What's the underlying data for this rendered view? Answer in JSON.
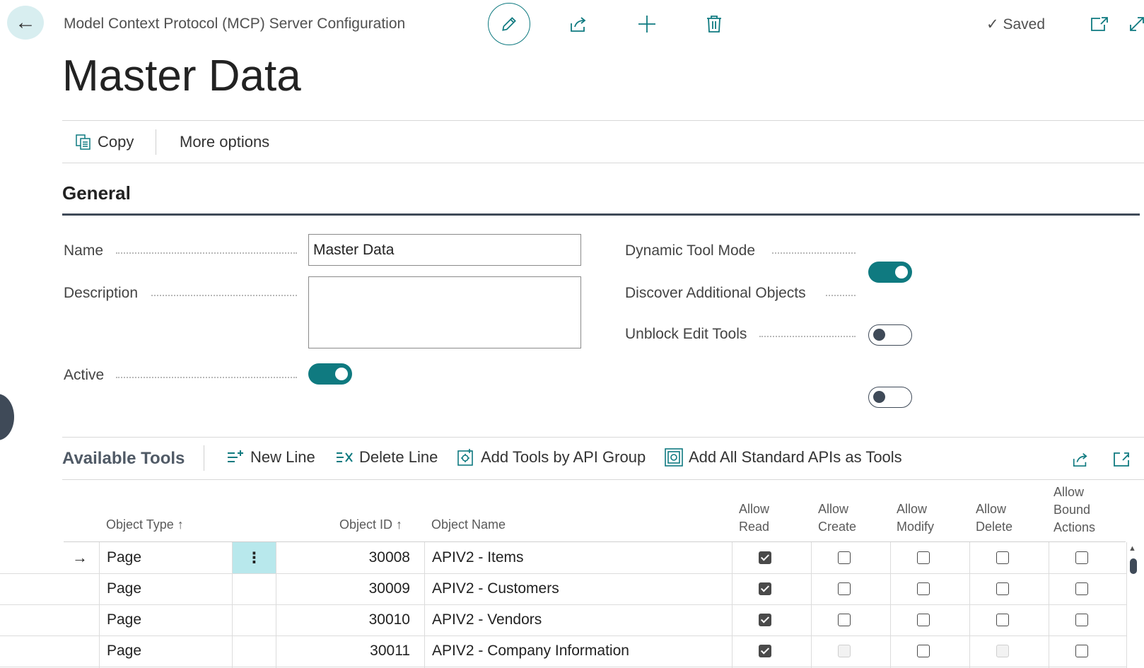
{
  "header": {
    "breadcrumb": "Model Context Protocol (MCP) Server Configuration",
    "saved_status": "Saved",
    "page_title": "Master Data",
    "accent_color": "#0f7a80"
  },
  "action_bar": {
    "copy_label": "Copy",
    "more_options_label": "More options"
  },
  "general": {
    "section_title": "General",
    "name_label": "Name",
    "name_value": "Master Data",
    "description_label": "Description",
    "description_value": "",
    "active_label": "Active",
    "active": true,
    "dynamic_tool_mode_label": "Dynamic Tool Mode",
    "dynamic_tool_mode": true,
    "discover_additional_objects_label": "Discover Additional Objects",
    "discover_additional_objects": false,
    "unblock_edit_tools_label": "Unblock Edit Tools",
    "unblock_edit_tools": false
  },
  "tools": {
    "title": "Available Tools",
    "actions": {
      "new_line": "New Line",
      "delete_line": "Delete Line",
      "add_by_api_group": "Add Tools by API Group",
      "add_all_standard": "Add All Standard APIs as Tools"
    },
    "columns": {
      "object_type": "Object Type",
      "object_id": "Object ID",
      "object_name": "Object Name",
      "allow_read": [
        "Allow",
        "Read"
      ],
      "allow_create": [
        "Allow",
        "Create"
      ],
      "allow_modify": [
        "Allow",
        "Modify"
      ],
      "allow_delete": [
        "Allow",
        "Delete"
      ],
      "allow_bound_actions": [
        "Allow",
        "Bound",
        "Actions"
      ]
    },
    "rows": [
      {
        "object_type": "Page",
        "object_id": "30008",
        "object_name": "APIV2 - Items",
        "read": true,
        "create": false,
        "modify": false,
        "delete": false,
        "bound": false,
        "create_disabled": false,
        "delete_disabled": false,
        "selected": true
      },
      {
        "object_type": "Page",
        "object_id": "30009",
        "object_name": "APIV2 - Customers",
        "read": true,
        "create": false,
        "modify": false,
        "delete": false,
        "bound": false,
        "create_disabled": false,
        "delete_disabled": false,
        "selected": false
      },
      {
        "object_type": "Page",
        "object_id": "30010",
        "object_name": "APIV2 - Vendors",
        "read": true,
        "create": false,
        "modify": false,
        "delete": false,
        "bound": false,
        "create_disabled": false,
        "delete_disabled": false,
        "selected": false
      },
      {
        "object_type": "Page",
        "object_id": "30011",
        "object_name": "APIV2 - Company Information",
        "read": true,
        "create": false,
        "modify": false,
        "delete": false,
        "bound": false,
        "create_disabled": true,
        "delete_disabled": true,
        "selected": false
      }
    ]
  }
}
